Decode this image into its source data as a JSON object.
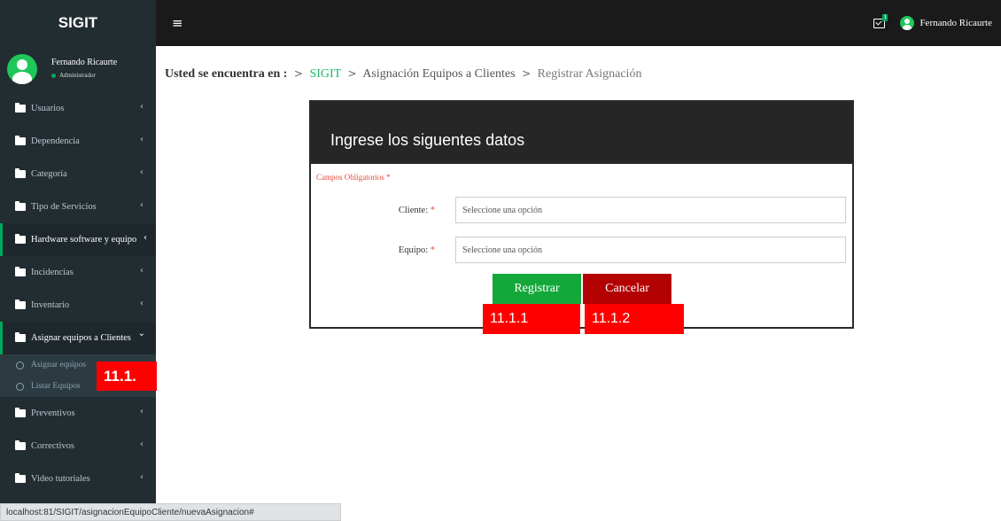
{
  "brand": "SIGIT",
  "topbar": {
    "menu_toggle": "≡",
    "notification_count": "1",
    "user_name": "Fernando Ricaurte"
  },
  "sidebar": {
    "user_name": "Fernando Ricaurte",
    "user_role": "Administrador",
    "items": [
      {
        "label": "Usuarios",
        "chevron": "‹"
      },
      {
        "label": "Dependencia",
        "chevron": "‹"
      },
      {
        "label": "Categoría",
        "chevron": "‹"
      },
      {
        "label": "Tipo de Servicios",
        "chevron": "‹"
      },
      {
        "label": "Hardware software y equipo",
        "chevron": "‹"
      },
      {
        "label": "Incidencias",
        "chevron": "‹"
      },
      {
        "label": "Inventario",
        "chevron": "‹"
      },
      {
        "label": "Asignar equipos a Clientes",
        "chevron": "⌄"
      },
      {
        "label": "Preventivos",
        "chevron": "‹"
      },
      {
        "label": "Correctivos",
        "chevron": "‹"
      },
      {
        "label": "Video tutoriales",
        "chevron": "‹"
      }
    ],
    "submenu": [
      {
        "label": "Asignar equipos"
      },
      {
        "label": "Listar Equipos"
      }
    ]
  },
  "breadcrumb": {
    "lead": "Usted se encuentra en :",
    "sep": ">",
    "items": [
      "SIGIT",
      "Asignación Equipos a Clientes",
      "Registrar Asignación"
    ]
  },
  "form": {
    "title": "Ingrese los siguentes datos",
    "required_note": "Campos Obligatorios *",
    "fields": [
      {
        "label": "Cliente:",
        "required": "*",
        "placeholder": "Seleccione una opción"
      },
      {
        "label": "Equipo:",
        "required": "*",
        "placeholder": "Seleccione una opción"
      }
    ],
    "submit_label": "Registrar",
    "cancel_label": "Cancelar"
  },
  "annotations": {
    "submenu_tag": "11.1.",
    "submit_tag": "11.1.1",
    "cancel_tag": "11.1.2"
  },
  "statusbar": {
    "url": "localhost:81/SIGIT/asignacionEquipoCliente/nuevaAsignacion#"
  },
  "colors": {
    "sidebar_bg": "#222d32",
    "topbar_bg": "#1a1a1a",
    "accent_green": "#14a83a",
    "cancel_red": "#b30000",
    "annotation_red": "#ff0000"
  }
}
